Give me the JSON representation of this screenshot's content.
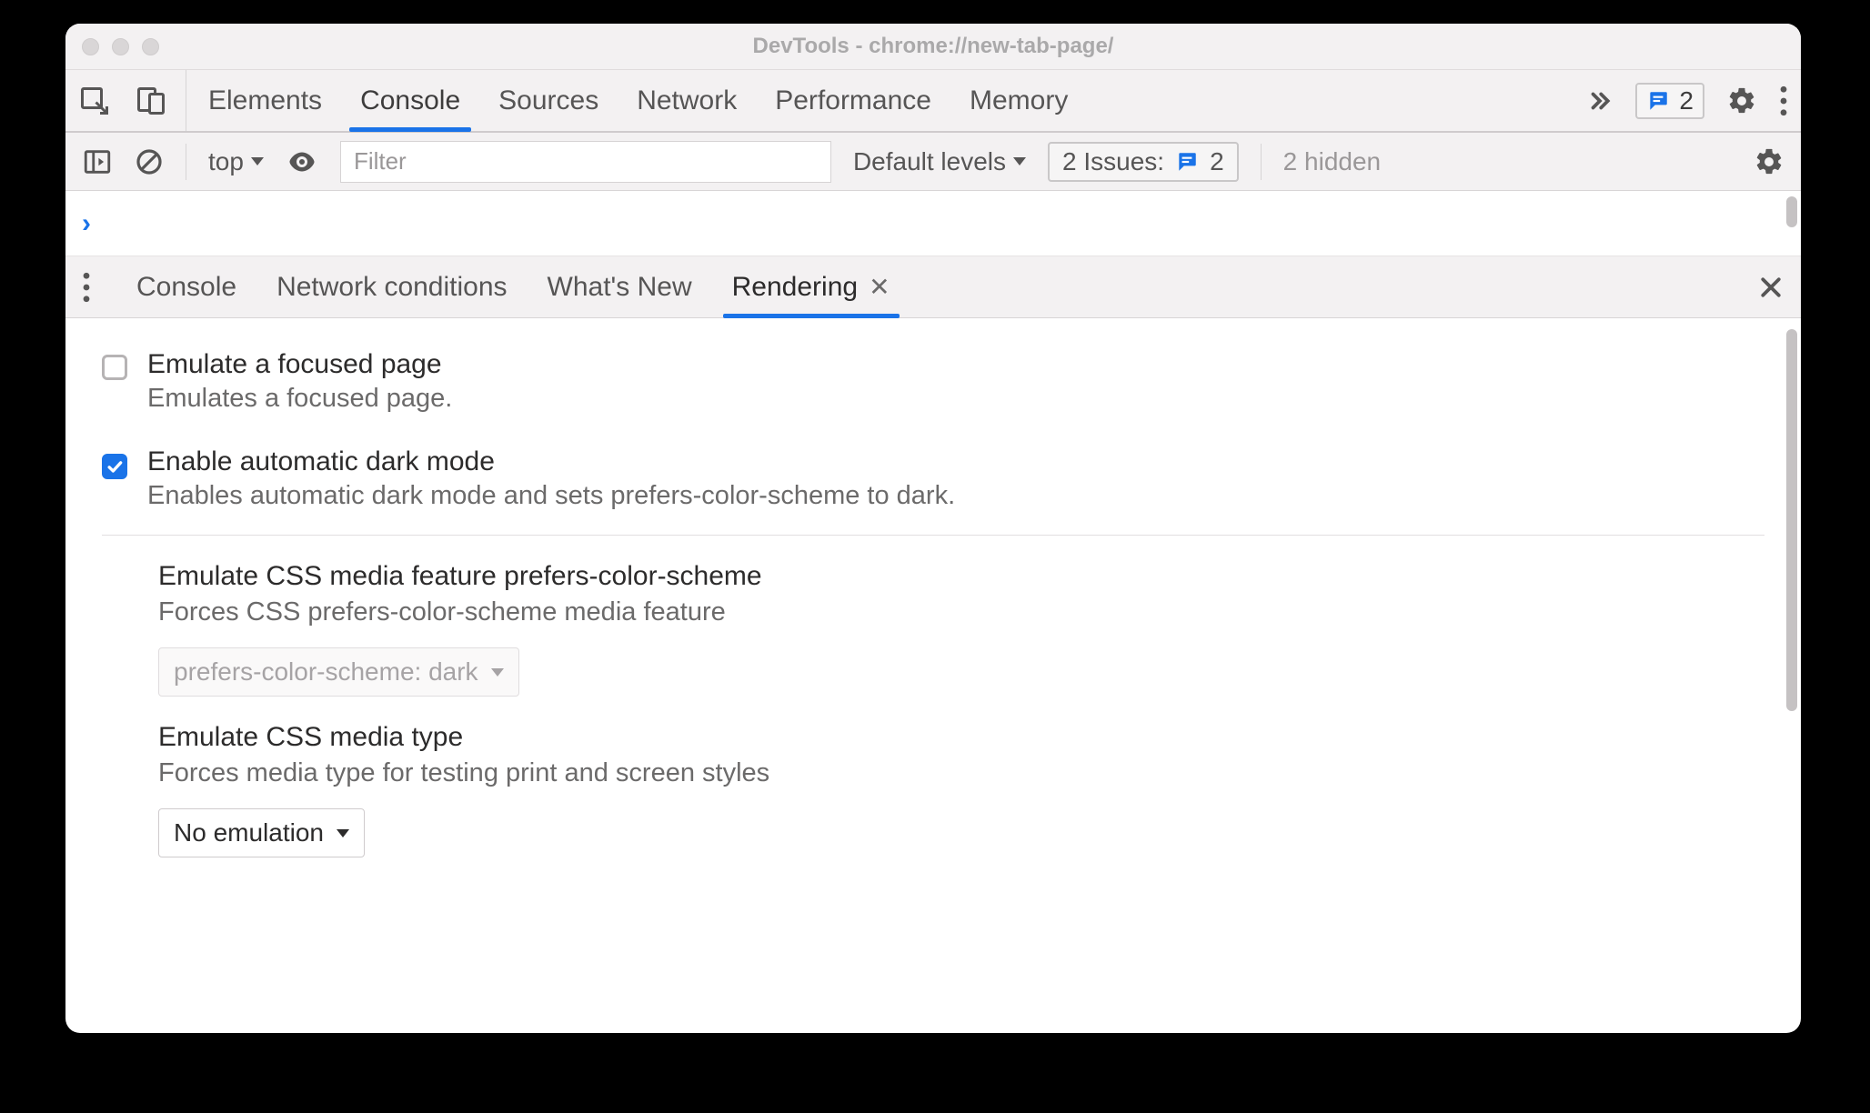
{
  "window": {
    "title": "DevTools - chrome://new-tab-page/"
  },
  "toolbar1": {
    "tabs": [
      "Elements",
      "Console",
      "Sources",
      "Network",
      "Performance",
      "Memory"
    ],
    "active_tab_index": 1,
    "chat_badge_count": "2"
  },
  "toolbar2": {
    "context_label": "top",
    "filter_placeholder": "Filter",
    "levels_label": "Default levels",
    "issues_label": "2 Issues:",
    "issues_count": "2",
    "hidden_label": "2 hidden"
  },
  "drawer": {
    "tabs": [
      "Console",
      "Network conditions",
      "What's New",
      "Rendering"
    ],
    "active_tab_index": 3
  },
  "rendering": {
    "opt_focused": {
      "label": "Emulate a focused page",
      "desc": "Emulates a focused page.",
      "checked": false
    },
    "opt_darkmode": {
      "label": "Enable automatic dark mode",
      "desc": "Enables automatic dark mode and sets prefers-color-scheme to dark.",
      "checked": true
    },
    "sel_pcs": {
      "label": "Emulate CSS media feature prefers-color-scheme",
      "desc": "Forces CSS prefers-color-scheme media feature",
      "value": "prefers-color-scheme: dark",
      "disabled": true
    },
    "sel_media": {
      "label": "Emulate CSS media type",
      "desc": "Forces media type for testing print and screen styles",
      "value": "No emulation",
      "disabled": false
    }
  }
}
